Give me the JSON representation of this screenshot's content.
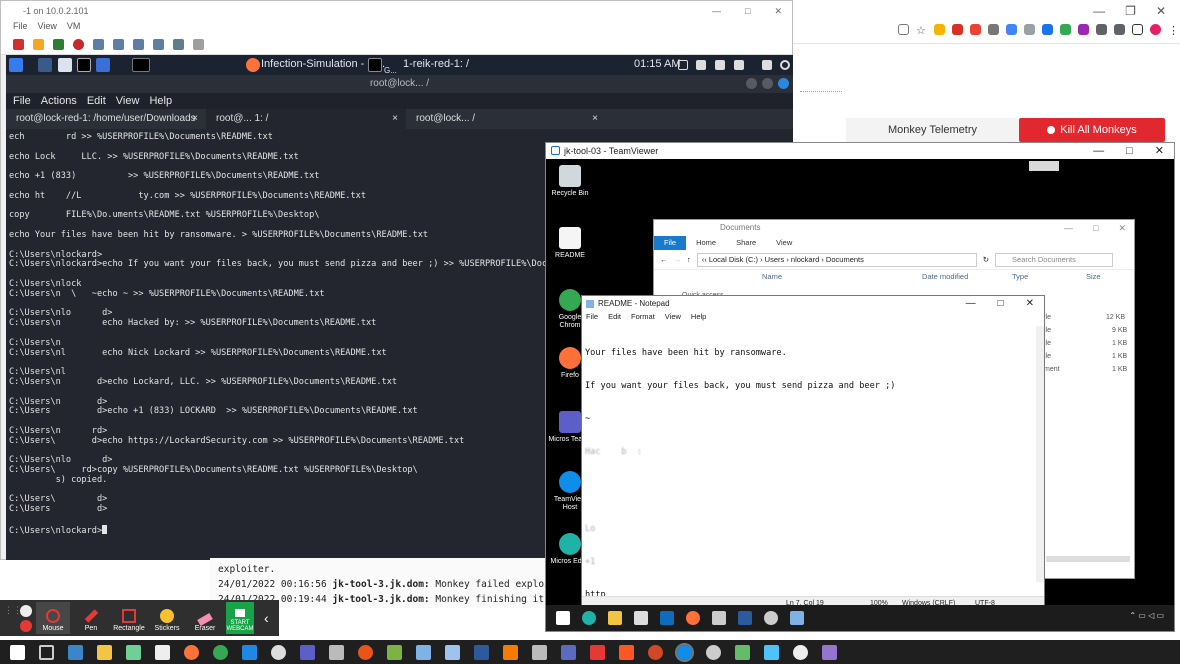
{
  "vm_window": {
    "title": "-1 on 10.0.2.101",
    "menu": [
      "File",
      "View",
      "VM"
    ],
    "ctl": [
      "—",
      "□",
      "✕"
    ]
  },
  "kali_panel": {
    "task1": "Infection-Simulation - G...",
    "task2": "1-reik-red-1: /",
    "task2_sub": "G...",
    "clock": "01:15 AM"
  },
  "terminal": {
    "title": "root@lock... /",
    "menu": [
      "File",
      "Actions",
      "Edit",
      "View",
      "Help"
    ],
    "tabs": [
      {
        "label": "root@lock-red-1: /home/user/Downloads"
      },
      {
        "label": "root@...   1: /"
      },
      {
        "label": "root@lock...   /"
      }
    ],
    "lines": [
      "ech        rd >> %USERPROFILE%\\Documents\\README.txt",
      "",
      "echo Lock     LLC. >> %USERPROFILE%\\Documents\\README.txt",
      "",
      "echo +1 (833)          >> %USERPROFILE%\\Documents\\README.txt",
      "",
      "echo ht    //L           ty.com >> %USERPROFILE%\\Documents\\README.txt",
      "",
      "copy       FILE%\\Do.uments\\README.txt %USERPROFILE%\\Desktop\\",
      "",
      "echo Your files have been hit by ransomware. > %USERPROFILE%\\Documents\\README.txt",
      "",
      "C:\\Users\\nlockard>",
      "C:\\Users\\nlockard>echo If you want your files back, you must send pizza and beer ;) >> %USERPROFILE%\\Documents\\README.txt",
      "",
      "C:\\Users\\nlock",
      "C:\\Users\\n  \\   ~echo ~ >> %USERPROFILE%\\Documents\\README.txt",
      "",
      "C:\\Users\\nlo      d>",
      "C:\\Users\\n        echo Hacked by: >> %USERPROFILE%\\Documents\\README.txt",
      "",
      "C:\\Users\\n",
      "C:\\Users\\nl       echo Nick Lockard >> %USERPROFILE%\\Documents\\README.txt",
      "",
      "C:\\Users\\nl",
      "C:\\Users\\n       d>echo Lockard, LLC. >> %USERPROFILE%\\Documents\\README.txt",
      "",
      "C:\\Users\\n       d>",
      "C:\\Users         d>echo +1 (833) LOCKARD  >> %USERPROFILE%\\Documents\\README.txt",
      "",
      "C:\\Users\\n      rd>",
      "C:\\Users\\       d>echo https://LockardSecurity.com >> %USERPROFILE%\\Documents\\README.txt",
      "",
      "C:\\Users\\nlo      d>",
      "C:\\Users\\     rd>copy %USERPROFILE%\\Documents\\README.txt %USERPROFILE%\\Desktop\\",
      "         s) copied.",
      "",
      "C:\\Users\\        d>",
      "C:\\Users         d>",
      "",
      "C:\\Users\\nlockard>"
    ]
  },
  "monkey_log": {
    "lines": [
      {
        "ts": "",
        "host": "",
        "msg": "exploiter."
      },
      {
        "ts": "24/01/2022 00:16:56",
        "host": "jk-tool-3.jk.dom:",
        "msg": "Monkey failed exploitin"
      },
      {
        "ts": "24/01/2022 00:19:44",
        "host": "jk-tool-3.jk.dom:",
        "msg": "Monkey finishing its ex"
      }
    ]
  },
  "monkey_panel": {
    "telemetry_label": "Monkey Telemetry",
    "kill_label": "Kill All Monkeys"
  },
  "annotation_toolbar": {
    "tools": [
      "Mouse",
      "Pen",
      "Rectangle",
      "Stickers",
      "Eraser"
    ],
    "webcam": [
      "START",
      "WEBCAM"
    ]
  },
  "teamviewer": {
    "title": "jk-tool-03 - TeamViewer",
    "ctl": [
      "—",
      "□",
      "✕"
    ],
    "desktop_icons": [
      {
        "label": "Recycle Bin"
      },
      {
        "label": "README"
      },
      {
        "label": "Google Chrom"
      },
      {
        "label": "Firefo"
      },
      {
        "label": "Micros Teams"
      },
      {
        "label": "TeamView Host"
      },
      {
        "label": "Micros Edge"
      }
    ]
  },
  "explorer": {
    "title": "Documents",
    "ctl": [
      "—",
      "□",
      "✕"
    ],
    "ribbon": [
      "File",
      "Home",
      "Share",
      "View"
    ],
    "path": "‹‹  Local Disk (C:)  ›  Users  ›  nlockard  ›  Documents",
    "search_placeholder": "Search Documents",
    "columns": [
      "Name",
      "Date modified",
      "Type",
      "Size"
    ],
    "quick_access": "Quick access",
    "types": [
      "ile",
      "ile",
      "ile",
      "ile",
      "ment"
    ],
    "sizes": [
      "12 KB",
      "9 KB",
      "1 KB",
      "1 KB",
      "1 KB"
    ]
  },
  "notepad": {
    "title": "README - Notepad",
    "ctl": [
      "—",
      "□",
      "✕"
    ],
    "menu": [
      "File",
      "Edit",
      "Format",
      "View",
      "Help"
    ],
    "lines": [
      "Your files have been hit by ransomware.",
      "If you want your files back, you must send pizza and beer ;)",
      "~",
      "Hac    b  :",
      "",
      "",
      "Lo   ",
      "+1   ",
      "http     "
    ],
    "status": {
      "pos": "Ln 7, Col 19",
      "zoom": "100%",
      "eol": "Windows (CRLF)",
      "enc": "UTF-8"
    }
  }
}
